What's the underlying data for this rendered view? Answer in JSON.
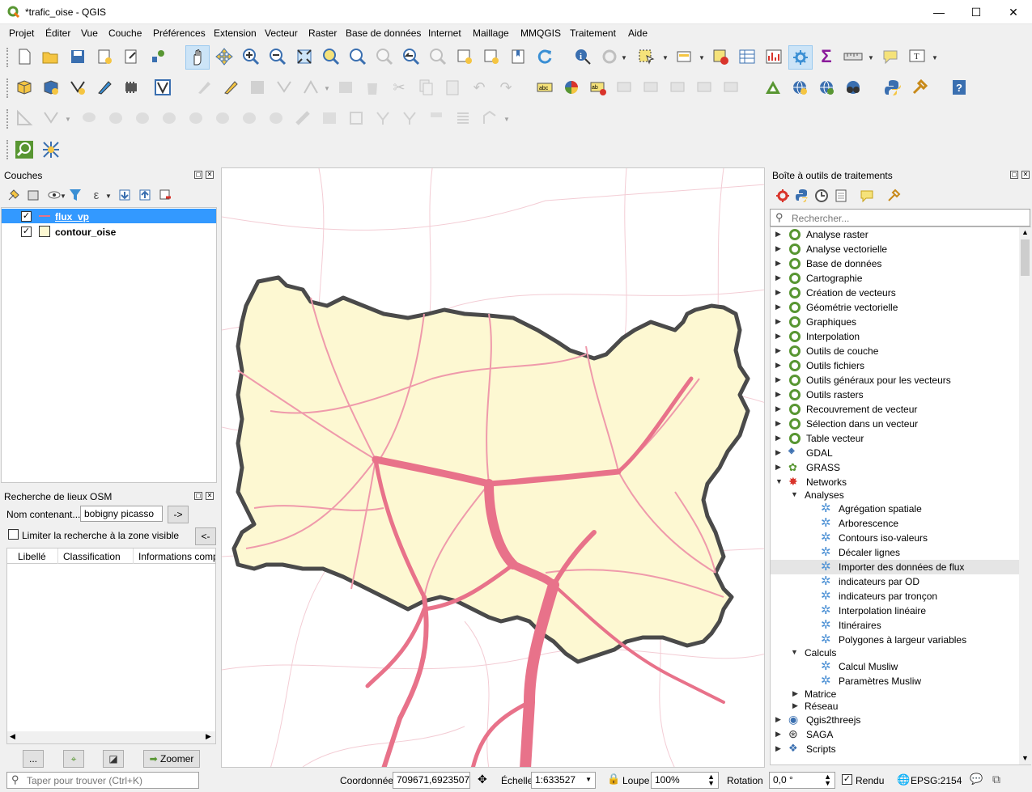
{
  "window": {
    "title": "*trafic_oise - QGIS",
    "minimize": "—",
    "maximize": "☐",
    "close": "✕"
  },
  "menu": [
    "Projet",
    "Éditer",
    "Vue",
    "Couche",
    "Préférences",
    "Extension",
    "Vecteur",
    "Raster",
    "Base de données",
    "Internet",
    "Maillage",
    "MMQGIS",
    "Traitement",
    "Aide"
  ],
  "layers_panel": {
    "title": "Couches",
    "layers": [
      {
        "name": "flux_vp",
        "checked": true,
        "selected": true
      },
      {
        "name": "contour_oise",
        "checked": true,
        "selected": false
      }
    ]
  },
  "osm_panel": {
    "title": "Recherche de lieux OSM",
    "name_label": "Nom contenant...",
    "name_value": "bobigny picasso",
    "go_label": "->",
    "limit_label": "Limiter la recherche à la zone visible",
    "back_label": "<-",
    "columns": [
      "Libellé",
      "Classification",
      "Informations comp"
    ],
    "more_label": "...",
    "zoom_label": "Zoomer"
  },
  "toolbox": {
    "title": "Boîte à outils de traitements",
    "search_placeholder": "Rechercher...",
    "groups": [
      "Analyse raster",
      "Analyse vectorielle",
      "Base de données",
      "Cartographie",
      "Création de vecteurs",
      "Géométrie vectorielle",
      "Graphiques",
      "Interpolation",
      "Outils de couche",
      "Outils fichiers",
      "Outils généraux pour les vecteurs",
      "Outils rasters",
      "Recouvrement de vecteur",
      "Sélection dans un vecteur",
      "Table vecteur",
      "GDAL",
      "GRASS",
      "Networks"
    ],
    "networks": {
      "analyses_label": "Analyses",
      "analyses": [
        "Agrégation spatiale",
        "Arborescence",
        "Contours iso-valeurs",
        "Décaler lignes",
        "Importer des données de flux",
        "indicateurs par OD",
        "indicateurs par tronçon",
        "Interpolation linéaire",
        "Itinéraires",
        "Polygones à largeur variables"
      ],
      "calculs_label": "Calculs",
      "calculs": [
        "Calcul Musliw",
        "Paramètres Musliw"
      ],
      "matrice_label": "Matrice",
      "reseau_label": "Réseau"
    },
    "bottom_groups": [
      "Qgis2threejs",
      "SAGA",
      "Scripts"
    ],
    "highlighted": "Importer des données de flux"
  },
  "status": {
    "search_placeholder": "Taper pour trouver (Ctrl+K)",
    "coord_label": "Coordonnée",
    "coord_value": "709671,6923507",
    "scale_label": "Échelle",
    "scale_value": "1:633527",
    "magnifier_label": "Loupe",
    "magnifier_value": "100%",
    "rotation_label": "Rotation",
    "rotation_value": "0,0 °",
    "render_label": "Rendu",
    "crs_label": "EPSG:2154"
  },
  "colors": {
    "flow": "#e8728a",
    "area": "#fdf8d2",
    "outline": "#4a4a4a",
    "selection": "#3399ff"
  }
}
